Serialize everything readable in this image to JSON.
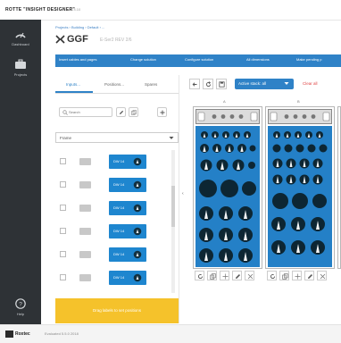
{
  "app": {
    "brand": "ROTTE \"INSIGHT DESIGNER\"",
    "brand_sub": "v 5.4.10"
  },
  "nav": {
    "dashboard": "Dashboard",
    "projects": "Projects",
    "help": "Help"
  },
  "breadcrumb": "Projects › Building › Default › ...",
  "page": {
    "title": "GGF",
    "subtitle": "E-Ser2 REV 2/6"
  },
  "actions": [
    "Insert cables and pages",
    "Change solution",
    "Configure solution",
    "All dimensions",
    "Make pending p"
  ],
  "tabs": [
    "Inputs...",
    "Positions...",
    "Spares"
  ],
  "search": {
    "placeholder": "Search"
  },
  "select": {
    "value": "Frame"
  },
  "items": [
    {
      "label": "DW 14"
    },
    {
      "label": "DW 14"
    },
    {
      "label": "DW 14"
    },
    {
      "label": "DW 14"
    },
    {
      "label": "DW 14"
    },
    {
      "label": "DW 14"
    }
  ],
  "warning": "Drag labels to set positions",
  "rack_toolbar": {
    "dropdown": "Active stack: all",
    "clear": "Clear all"
  },
  "columns": [
    "A",
    "B"
  ],
  "colors": {
    "accent": "#2f82c7",
    "panel_blue": "#2480c7",
    "sidebar": "#2e3236",
    "warning": "#f5c22b",
    "danger": "#e04646"
  },
  "footer": {
    "brand": "Roxtec",
    "version": "Evaluated 5.5.0 2018"
  }
}
